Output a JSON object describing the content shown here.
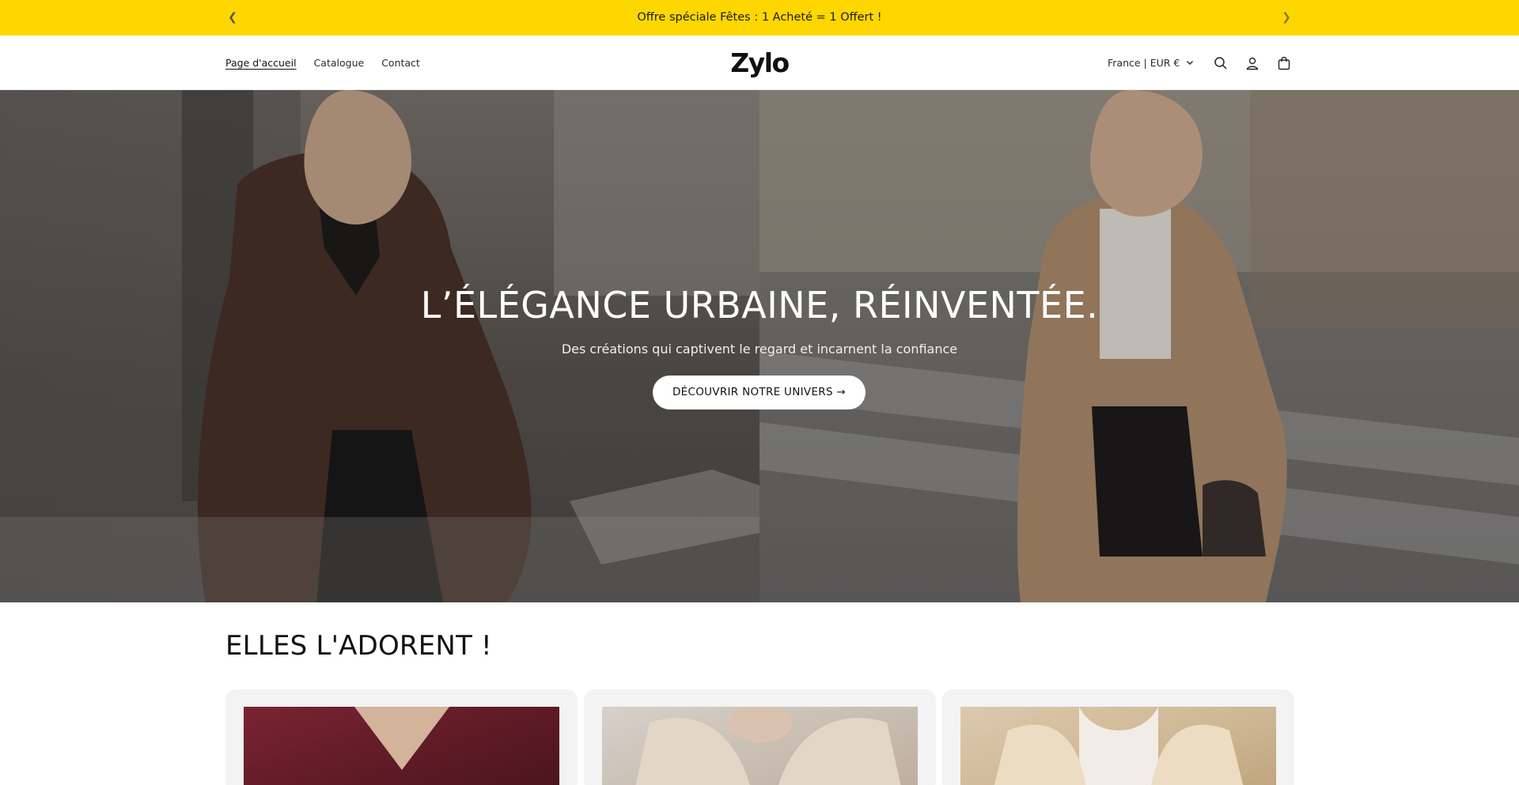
{
  "announcement": {
    "text": "Offre spéciale Fêtes   : 1 Acheté = 1 Offert !",
    "prev_icon": "chevron-left-icon",
    "next_icon": "chevron-right-icon"
  },
  "header": {
    "nav": [
      "Page d'accueil",
      "Catalogue",
      "Contact"
    ],
    "logo": "Zylo",
    "currency": "France | EUR €",
    "icons": [
      "search-icon",
      "account-icon",
      "cart-icon"
    ]
  },
  "hero": {
    "title": "L’ÉLÉGANCE URBAINE, RÉINVENTÉE.",
    "subtitle": "Des créations qui captivent le regard et incarnent la confiance",
    "cta": "DÉCOUVRIR NOTRE UNIVERS →"
  },
  "featured": {
    "title": "ELLES L'ADORENT !",
    "cards": [
      {
        "image_color": "#6a1f2b"
      },
      {
        "image_color": "#cfc3b4"
      },
      {
        "image_color": "#d9c4a3"
      }
    ]
  },
  "colors": {
    "announcement_bg": "#ffd700",
    "button_bg": "#ffffff",
    "text": "#121212"
  }
}
